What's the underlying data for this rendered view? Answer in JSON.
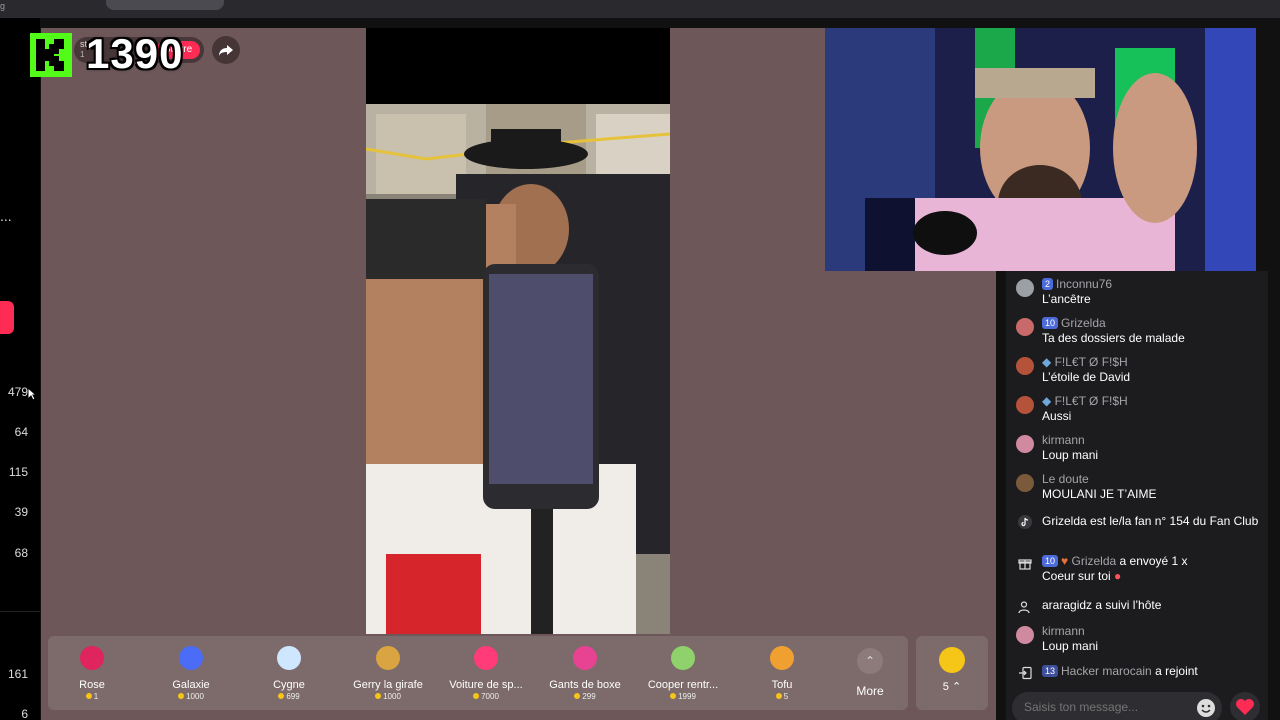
{
  "browser": {
    "tab_title": "g",
    "tab_pill": ""
  },
  "rail": {
    "dots": "...",
    "numbers": [
      "479",
      "64",
      "115",
      "39",
      "68",
      "161",
      "6"
    ]
  },
  "overlay": {
    "score": "1390",
    "live_label": "Suivre",
    "host_name": "st",
    "host_likes": "1"
  },
  "chat": {
    "messages": [
      {
        "badge": "2",
        "user": "Inconnu76",
        "text": "L’ancêtre"
      },
      {
        "badge": "10",
        "user": "Grizelda",
        "text": "Ta des dossiers de malade"
      },
      {
        "badge": "",
        "user": "F!L€T Ø F!$H",
        "text": "L’étoile de David"
      },
      {
        "badge": "",
        "user": "F!L€T Ø F!$H",
        "text": "Aussi"
      },
      {
        "badge": "",
        "user": "kirmann",
        "text": "Loup mani"
      },
      {
        "badge": "",
        "user": "Le doute",
        "text": "MOULANI JE T’AIME"
      }
    ],
    "fanclub": "Grizelda est le/la fan n° 154 du Fan Club",
    "gift_event": {
      "badge": "10",
      "user": "Grizelda",
      "action": "a envoyé 1 x",
      "gift": "Coeur sur toi"
    },
    "follow_event": {
      "user": "araragidz",
      "action": "a suivi l’hôte"
    },
    "last_message": {
      "user": "kirmann",
      "text": "Loup mani"
    },
    "join_event": {
      "badge": "13",
      "user": "Hacker marocain",
      "action": "a rejoint"
    },
    "input_placeholder": "Saisis ton message..."
  },
  "gifts": [
    {
      "name": "Rose",
      "price": "1",
      "color": "#e0245e"
    },
    {
      "name": "Galaxie",
      "price": "1000",
      "color": "#4b6cf7"
    },
    {
      "name": "Cygne",
      "price": "699",
      "color": "#cfe6ff"
    },
    {
      "name": "Gerry la girafe",
      "price": "1000",
      "color": "#d9a441"
    },
    {
      "name": "Voiture de sp...",
      "price": "7000",
      "color": "#ff3b7a"
    },
    {
      "name": "Gants de boxe",
      "price": "299",
      "color": "#e84393"
    },
    {
      "name": "Cooper rentr...",
      "price": "1999",
      "color": "#8fd16a"
    },
    {
      "name": "Tofu",
      "price": "5",
      "color": "#f0a030"
    }
  ],
  "more_label": "More",
  "coin_balance": "5"
}
